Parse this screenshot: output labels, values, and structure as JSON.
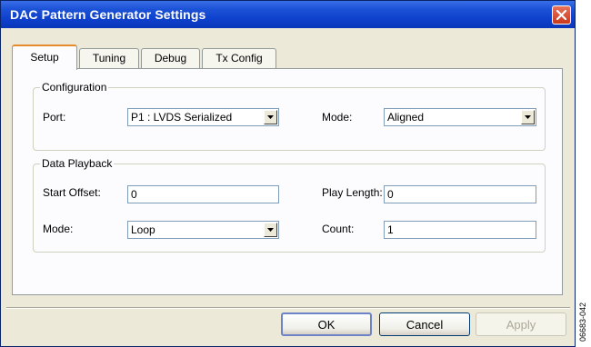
{
  "window": {
    "title": "DAC Pattern Generator Settings"
  },
  "tabs": [
    {
      "label": "Setup",
      "active": true
    },
    {
      "label": "Tuning",
      "active": false
    },
    {
      "label": "Debug",
      "active": false
    },
    {
      "label": "Tx Config",
      "active": false
    }
  ],
  "configuration": {
    "title": "Configuration",
    "port_label": "Port:",
    "port_value": "P1 : LVDS Serialized",
    "mode_label": "Mode:",
    "mode_value": "Aligned"
  },
  "data_playback": {
    "title": "Data Playback",
    "start_offset_label": "Start Offset:",
    "start_offset_value": "0",
    "play_length_label": "Play Length:",
    "play_length_value": "0",
    "mode_label": "Mode:",
    "mode_value": "Loop",
    "count_label": "Count:",
    "count_value": "1"
  },
  "buttons": {
    "ok": "OK",
    "cancel": "Cancel",
    "apply": "Apply"
  },
  "figure_id": "06683-042",
  "icons": {
    "close": "close-icon",
    "dropdown": "chevron-down-icon"
  },
  "colors": {
    "titlebar": "#0a37b8",
    "active_tab_accent": "#e68b2c",
    "close_button": "#c8381c"
  }
}
